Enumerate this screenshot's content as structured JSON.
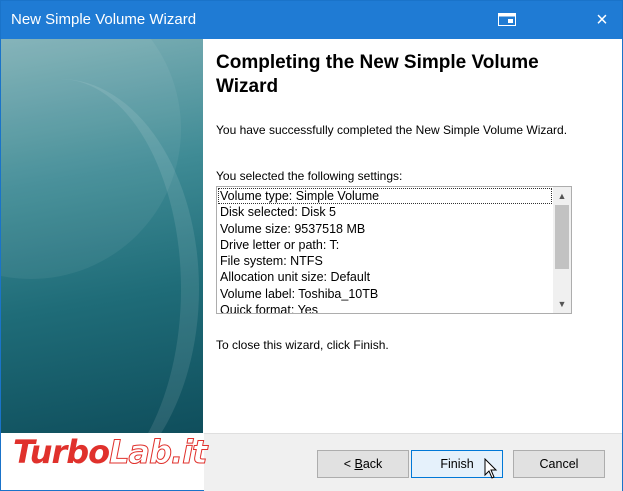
{
  "window": {
    "title": "New Simple Volume Wizard"
  },
  "titlebar_icons": [
    "restore-window-icon",
    "close-icon"
  ],
  "close_glyph": "×",
  "content": {
    "heading": "Completing the New Simple Volume Wizard",
    "success_text": "You have successfully completed the New Simple Volume Wizard.",
    "settings_label": "You selected the following settings:",
    "settings": [
      "Volume type: Simple Volume",
      "Disk selected: Disk 5",
      "Volume size: 9537518 MB",
      "Drive letter or path: T:",
      "File system: NTFS",
      "Allocation unit size: Default",
      "Volume label: Toshiba_10TB",
      "Quick format: Yes"
    ],
    "close_instruction": "To close this wizard, click Finish."
  },
  "buttons": {
    "back_prefix": "< ",
    "back_accel": "B",
    "back_rest": "ack",
    "finish": "Finish",
    "cancel": "Cancel"
  },
  "watermark": {
    "part1": "Turbo",
    "part2": "Lab.it"
  },
  "colors": {
    "titlebar": "#1f7bd4",
    "watermark": "#e0312c"
  }
}
